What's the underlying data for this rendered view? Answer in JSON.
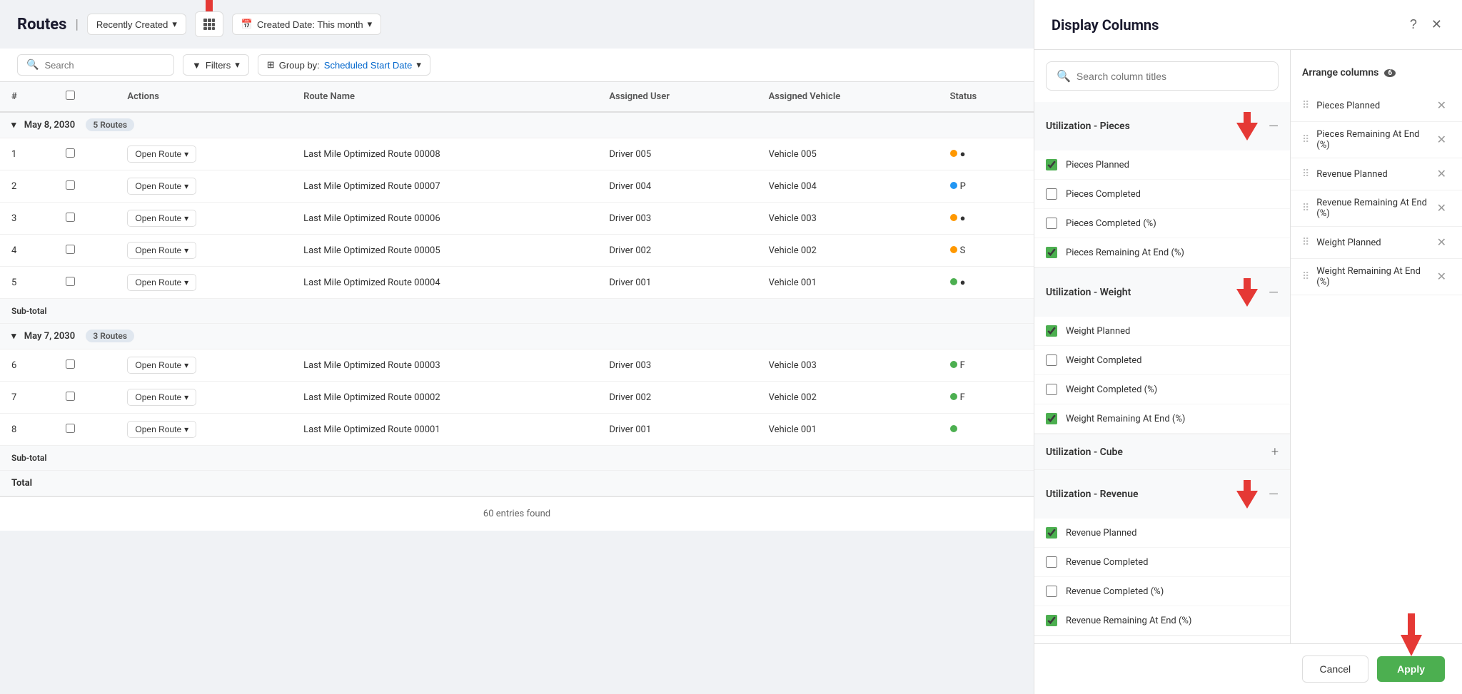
{
  "routes": {
    "title": "Routes",
    "filter_label": "Recently Created",
    "date_filter": "Created Date: This month",
    "search_placeholder": "Search",
    "filter_btn": "Filters",
    "group_btn": "Group by:",
    "group_value": "Scheduled Start Date",
    "entries_found": "60 entries found",
    "columns": [
      "#",
      "Actions",
      "Route Name",
      "Assigned User",
      "Assigned Vehicle",
      "Status"
    ],
    "groups": [
      {
        "date": "May 8, 2030",
        "count": "5 Routes",
        "rows": [
          {
            "num": "1",
            "action": "Open Route",
            "name": "Last Mile Optimized Route 00008",
            "user": "Driver 005",
            "vehicle": "Vehicle 005",
            "status": "●",
            "status_color": "orange"
          },
          {
            "num": "2",
            "action": "Open Route",
            "name": "Last Mile Optimized Route 00007",
            "user": "Driver 004",
            "vehicle": "Vehicle 004",
            "status": "P",
            "status_color": "blue"
          },
          {
            "num": "3",
            "action": "Open Route",
            "name": "Last Mile Optimized Route 00006",
            "user": "Driver 003",
            "vehicle": "Vehicle 003",
            "status": "●",
            "status_color": "orange"
          },
          {
            "num": "4",
            "action": "Open Route",
            "name": "Last Mile Optimized Route 00005",
            "user": "Driver 002",
            "vehicle": "Vehicle 002",
            "status": "S",
            "status_color": "orange"
          },
          {
            "num": "5",
            "action": "Open Route",
            "name": "Last Mile Optimized Route 00004",
            "user": "Driver 001",
            "vehicle": "Vehicle 001",
            "status": "●",
            "status_color": "green"
          }
        ],
        "subtotal": "Sub-total"
      },
      {
        "date": "May 7, 2030",
        "count": "3 Routes",
        "rows": [
          {
            "num": "6",
            "action": "Open Route",
            "name": "Last Mile Optimized Route 00003",
            "user": "Driver 003",
            "vehicle": "Vehicle 003",
            "status": "F",
            "status_color": "green"
          },
          {
            "num": "7",
            "action": "Open Route",
            "name": "Last Mile Optimized Route 00002",
            "user": "Driver 002",
            "vehicle": "Vehicle 002",
            "status": "F",
            "status_color": "green"
          },
          {
            "num": "8",
            "action": "Open Route",
            "name": "Last Mile Optimized Route 00001",
            "user": "Driver 001",
            "vehicle": "Vehicle 001",
            "status": "",
            "status_color": "green"
          }
        ],
        "subtotal": "Sub-total"
      }
    ],
    "total": "Total"
  },
  "display_columns": {
    "title": "Display Columns",
    "search_placeholder": "Search column titles",
    "sections": [
      {
        "id": "pieces",
        "title": "Utilization - Pieces",
        "expanded": true,
        "toggle": "—",
        "items": [
          {
            "label": "Pieces Planned",
            "checked": true
          },
          {
            "label": "Pieces Completed",
            "checked": false
          },
          {
            "label": "Pieces Completed (%)",
            "checked": false
          },
          {
            "label": "Pieces Remaining At End (%)",
            "checked": true
          }
        ]
      },
      {
        "id": "weight",
        "title": "Utilization - Weight",
        "expanded": true,
        "toggle": "—",
        "items": [
          {
            "label": "Weight Planned",
            "checked": true
          },
          {
            "label": "Weight Completed",
            "checked": false
          },
          {
            "label": "Weight Completed (%)",
            "checked": false
          },
          {
            "label": "Weight Remaining At End (%)",
            "checked": true
          }
        ]
      },
      {
        "id": "cube",
        "title": "Utilization - Cube",
        "expanded": false,
        "toggle": "+",
        "items": []
      },
      {
        "id": "revenue",
        "title": "Utilization - Revenue",
        "expanded": true,
        "toggle": "—",
        "items": [
          {
            "label": "Revenue Planned",
            "checked": true
          },
          {
            "label": "Revenue Completed",
            "checked": false
          },
          {
            "label": "Revenue Completed (%)",
            "checked": false
          },
          {
            "label": "Revenue Remaining At End (%)",
            "checked": true
          }
        ]
      }
    ],
    "arrange": {
      "title": "Arrange columns",
      "badge": "6",
      "items": [
        {
          "label": "Pieces Planned"
        },
        {
          "label": "Pieces Remaining At End (%)"
        },
        {
          "label": "Revenue Planned"
        },
        {
          "label": "Revenue Remaining At End (%)"
        },
        {
          "label": "Weight Planned"
        },
        {
          "label": "Weight Remaining At End (%)"
        }
      ]
    },
    "footer": {
      "cancel_label": "Cancel",
      "apply_label": "Apply"
    }
  }
}
